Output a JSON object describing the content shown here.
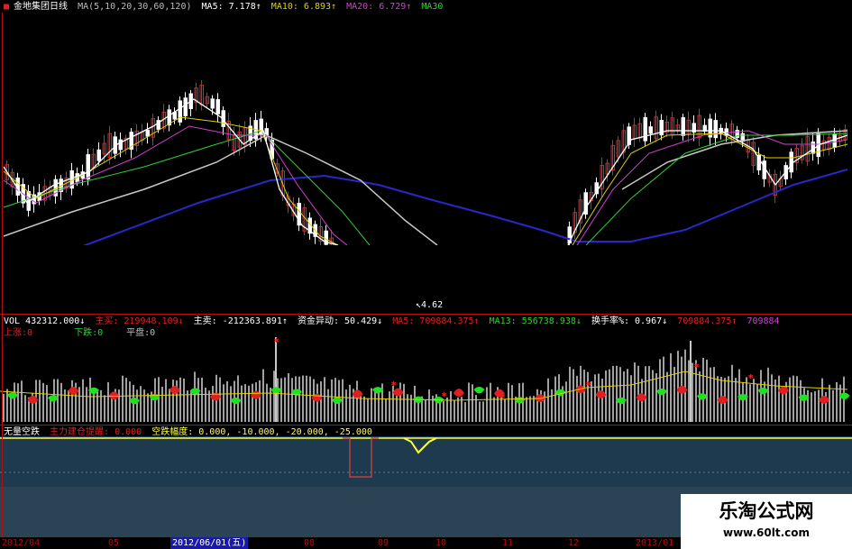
{
  "header": {
    "stock_name": "金地集团",
    "period": "日线",
    "ma_params": "MA(5,10,20,30,60,120)",
    "ma5": "MA5: 7.178↑",
    "ma10": "MA10: 6.893↑",
    "ma20": "MA20: 6.729↑",
    "ma30": "MA30",
    "low_marker": "4.62"
  },
  "volume_panel": {
    "vol": "VOL 432312.000↓",
    "buy": "主买: 219948.109↓",
    "sell": "主卖: -212363.891↑",
    "fund_change": "资金异动: 50.429↓",
    "ma5": "MA5: 709884.375↑",
    "ma13": "MA13: 556738.938↓",
    "turnover": "换手率%: 0.967↓",
    "ma_last": "709884.375↑",
    "ma_tail": "709884",
    "rise": "上涨:0",
    "fall": "下跌:0",
    "flat": "平盘:0"
  },
  "indicator_panel": {
    "name": "无量空跌",
    "alert": "主力建仓提醒: 0.000",
    "amplitude": "空跌幅度: 0.000, -10.000, -20.000, -25.000"
  },
  "date_axis": {
    "labels": [
      "2012/04",
      "05",
      "2012/06/01(五)",
      "08",
      "09",
      "10",
      "11",
      "12",
      "2013/01"
    ],
    "selected": "2012/06/01(五)"
  },
  "watermark": {
    "title": "乐淘公式网",
    "url": "www.60lt.com"
  },
  "colors": {
    "ma5": "#ffffff",
    "ma10": "#e0d000",
    "ma20": "#d040d0",
    "ma30": "#30d030",
    "ma60": "#c8c8c8",
    "ma120": "#2828c8",
    "up": "#e02020",
    "vol_green": "#20e020",
    "vol_red": "#e02020",
    "indicator_bg": "#1e3a4e"
  }
}
